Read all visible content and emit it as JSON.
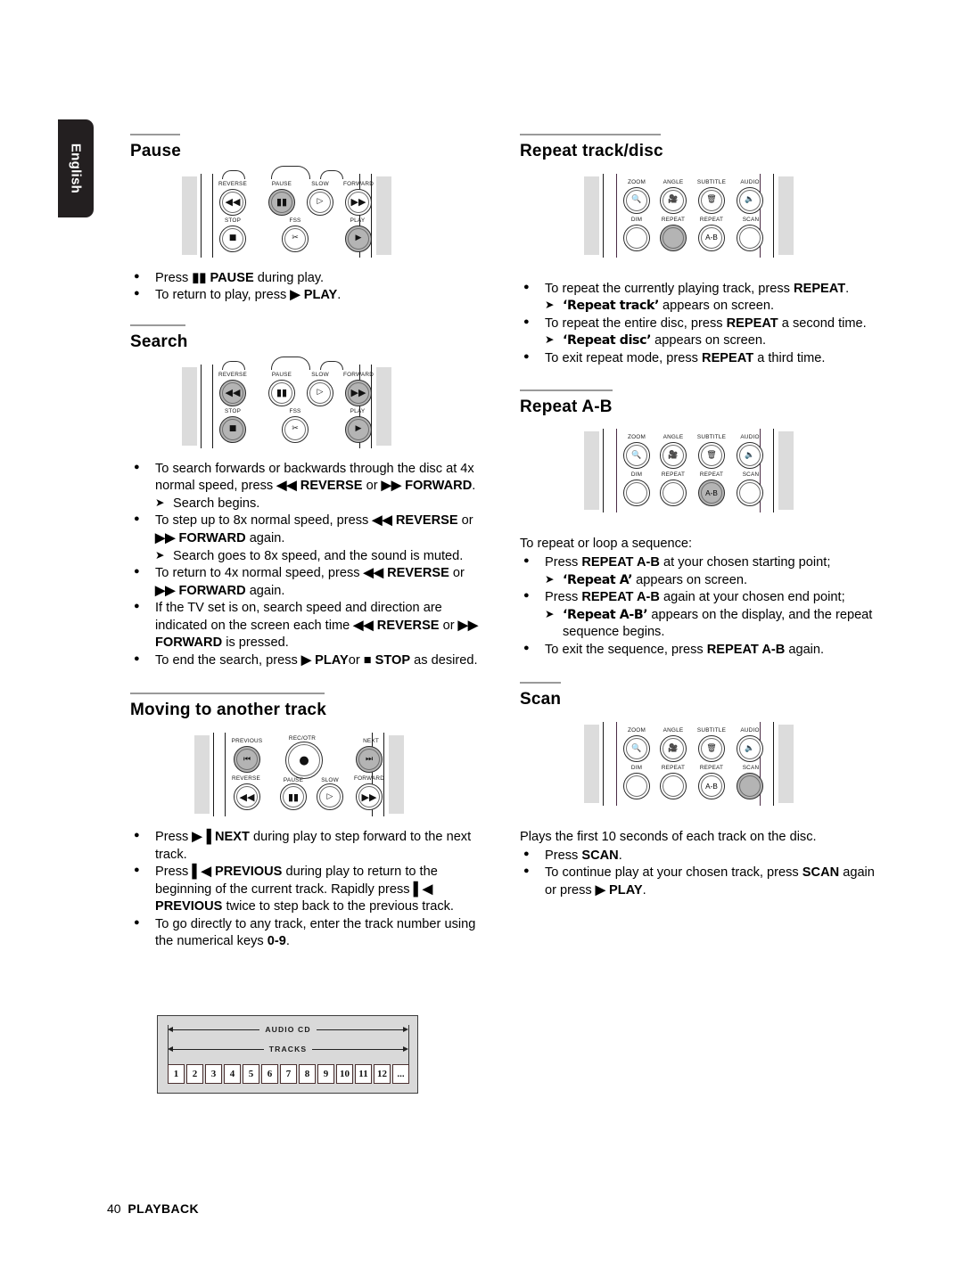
{
  "language_tab": {
    "label": "English"
  },
  "footer": {
    "page_number": "40",
    "section": "PLAYBACK"
  },
  "left_column": {
    "pause": {
      "heading": "Pause",
      "remote_labels": [
        "REVERSE",
        "PAUSE",
        "SLOW",
        "FORWARD",
        "STOP",
        "FSS",
        "PLAY"
      ],
      "highlighted_buttons": [
        "PAUSE",
        "PLAY"
      ],
      "bullets": [
        {
          "parts": [
            {
              "t": "Press ",
              "b": false
            },
            {
              "t": "▮▮",
              "b": true
            },
            {
              "t": " PAUSE",
              "b": true
            },
            {
              "t": " during play.",
              "b": false
            }
          ]
        },
        {
          "parts": [
            {
              "t": "To return to play, press ",
              "b": false
            },
            {
              "t": "▶",
              "b": true
            },
            {
              "t": " PLAY",
              "b": true
            },
            {
              "t": ".",
              "b": false
            }
          ]
        }
      ]
    },
    "search": {
      "heading": "Search",
      "remote_labels": [
        "REVERSE",
        "PAUSE",
        "SLOW",
        "FORWARD",
        "STOP",
        "FSS",
        "PLAY"
      ],
      "highlighted_buttons": [
        "REVERSE",
        "STOP",
        "FORWARD",
        "PLAY"
      ],
      "bullets": [
        {
          "parts": [
            {
              "t": "To search forwards or backwards through the disc at 4x normal speed, press ",
              "b": false
            },
            {
              "t": "◀◀ REVERSE",
              "b": true
            },
            {
              "t": " or ",
              "b": false
            },
            {
              "t": "▶▶ FORWARD",
              "b": true
            },
            {
              "t": ".",
              "b": false
            }
          ],
          "arrow": "Search begins."
        },
        {
          "parts": [
            {
              "t": "To step up to 8x normal speed, press ",
              "b": false
            },
            {
              "t": "◀◀ REVERSE",
              "b": true
            },
            {
              "t": " or ",
              "b": false
            },
            {
              "t": "▶▶ FORWARD",
              "b": true
            },
            {
              "t": " again.",
              "b": false
            }
          ],
          "arrow": "Search goes to 8x speed, and the sound is muted."
        },
        {
          "parts": [
            {
              "t": "To return to 4x normal speed, press ",
              "b": false
            },
            {
              "t": "◀◀ REVERSE",
              "b": true
            },
            {
              "t": " or ",
              "b": false
            },
            {
              "t": "▶▶ FORWARD",
              "b": true
            },
            {
              "t": " again.",
              "b": false
            }
          ]
        },
        {
          "parts": [
            {
              "t": "If the TV set is on, search speed and direction are indicated on the screen each time ",
              "b": false
            },
            {
              "t": "◀◀ REVERSE",
              "b": true
            },
            {
              "t": " or ",
              "b": false
            },
            {
              "t": "▶▶ FORWARD",
              "b": true
            },
            {
              "t": " is pressed.",
              "b": false
            }
          ]
        },
        {
          "parts": [
            {
              "t": "To end the search, press ",
              "b": false
            },
            {
              "t": "▶ PLAY",
              "b": true
            },
            {
              "t": "or ",
              "b": false
            },
            {
              "t": "■ STOP",
              "b": true
            },
            {
              "t": " as desired.",
              "b": false
            }
          ]
        }
      ]
    },
    "moving": {
      "heading": "Moving to another track",
      "remote_labels": [
        "PREVIOUS",
        "REC/OTR",
        "NEXT",
        "REVERSE",
        "PAUSE",
        "SLOW",
        "FORWARD"
      ],
      "highlighted_buttons": [
        "PREVIOUS",
        "NEXT"
      ],
      "bullets": [
        {
          "parts": [
            {
              "t": "Press ",
              "b": false
            },
            {
              "t": "▶▐",
              "b": true
            },
            {
              "t": " NEXT",
              "b": true
            },
            {
              "t": " during play to step forward to the next track.",
              "b": false
            }
          ]
        },
        {
          "parts": [
            {
              "t": "Press ",
              "b": false
            },
            {
              "t": "▌◀",
              "b": true
            },
            {
              "t": " PREVIOUS",
              "b": true
            },
            {
              "t": " during play to return to the beginning of the current track. Rapidly press ",
              "b": false
            },
            {
              "t": "▌◀ PREVIOUS",
              "b": true
            },
            {
              "t": " twice to step back to the previous track.",
              "b": false
            }
          ]
        },
        {
          "parts": [
            {
              "t": "To go directly to any track, enter the track number using the numerical keys ",
              "b": false
            },
            {
              "t": "0-9",
              "b": true
            },
            {
              "t": ".",
              "b": false
            }
          ]
        }
      ]
    },
    "audio_cd_figure": {
      "top_label": "AUDIO CD",
      "bottom_label": "TRACKS",
      "tracks": [
        "1",
        "2",
        "3",
        "4",
        "5",
        "6",
        "7",
        "8",
        "9",
        "10",
        "11",
        "12",
        "..."
      ]
    }
  },
  "right_column": {
    "repeat_track_disc": {
      "heading": "Repeat track/disc",
      "remote_labels": [
        "ZOOM",
        "ANGLE",
        "SUBTITLE",
        "AUDIO",
        "DIM",
        "REPEAT",
        "REPEAT",
        "SCAN"
      ],
      "highlighted_buttons": [
        "REPEAT"
      ],
      "bullets": [
        {
          "parts": [
            {
              "t": "To repeat the currently playing track, press ",
              "b": false
            },
            {
              "t": "REPEAT",
              "b": true
            },
            {
              "t": ".",
              "b": false
            }
          ],
          "arrow_osd": "‘Repeat track’",
          "arrow_tail": " appears on screen."
        },
        {
          "parts": [
            {
              "t": "To repeat the entire disc, press ",
              "b": false
            },
            {
              "t": "REPEAT",
              "b": true
            },
            {
              "t": " a second time.",
              "b": false
            }
          ],
          "arrow_osd": "‘Repeat disc’",
          "arrow_tail": " appears on screen."
        },
        {
          "parts": [
            {
              "t": "To exit repeat mode, press ",
              "b": false
            },
            {
              "t": "REPEAT",
              "b": true
            },
            {
              "t": " a third time.",
              "b": false
            }
          ]
        }
      ]
    },
    "repeat_ab": {
      "heading": "Repeat A-B",
      "remote_labels": [
        "ZOOM",
        "ANGLE",
        "SUBTITLE",
        "AUDIO",
        "DIM",
        "REPEAT",
        "REPEAT",
        "SCAN"
      ],
      "highlighted_buttons": [
        "REPEAT A-B"
      ],
      "intro": "To repeat or loop a sequence:",
      "bullets": [
        {
          "parts": [
            {
              "t": "Press ",
              "b": false
            },
            {
              "t": "REPEAT A-B",
              "b": true
            },
            {
              "t": " at your chosen starting point;",
              "b": false
            }
          ],
          "arrow_osd": "‘Repeat A’",
          "arrow_tail": " appears on screen."
        },
        {
          "parts": [
            {
              "t": "Press ",
              "b": false
            },
            {
              "t": "REPEAT A-B",
              "b": true
            },
            {
              "t": " again at your chosen end point;",
              "b": false
            }
          ],
          "arrow_osd": "‘Repeat A-B’",
          "arrow_tail": " appears on the display, and the repeat sequence begins."
        },
        {
          "parts": [
            {
              "t": "To exit the sequence, press ",
              "b": false
            },
            {
              "t": "REPEAT A-B",
              "b": true
            },
            {
              "t": " again.",
              "b": false
            }
          ]
        }
      ]
    },
    "scan": {
      "heading": "Scan",
      "remote_labels": [
        "ZOOM",
        "ANGLE",
        "SUBTITLE",
        "AUDIO",
        "DIM",
        "REPEAT",
        "REPEAT",
        "SCAN"
      ],
      "highlighted_buttons": [
        "SCAN"
      ],
      "intro": "Plays the first 10 seconds of each track on the disc.",
      "bullets": [
        {
          "parts": [
            {
              "t": "Press ",
              "b": false
            },
            {
              "t": "SCAN",
              "b": true
            },
            {
              "t": ".",
              "b": false
            }
          ]
        },
        {
          "parts": [
            {
              "t": "To continue play at your chosen track, press ",
              "b": false
            },
            {
              "t": "SCAN",
              "b": true
            },
            {
              "t": " again or press ",
              "b": false
            },
            {
              "t": "▶ PLAY",
              "b": true
            },
            {
              "t": ".",
              "b": false
            }
          ]
        }
      ]
    }
  }
}
